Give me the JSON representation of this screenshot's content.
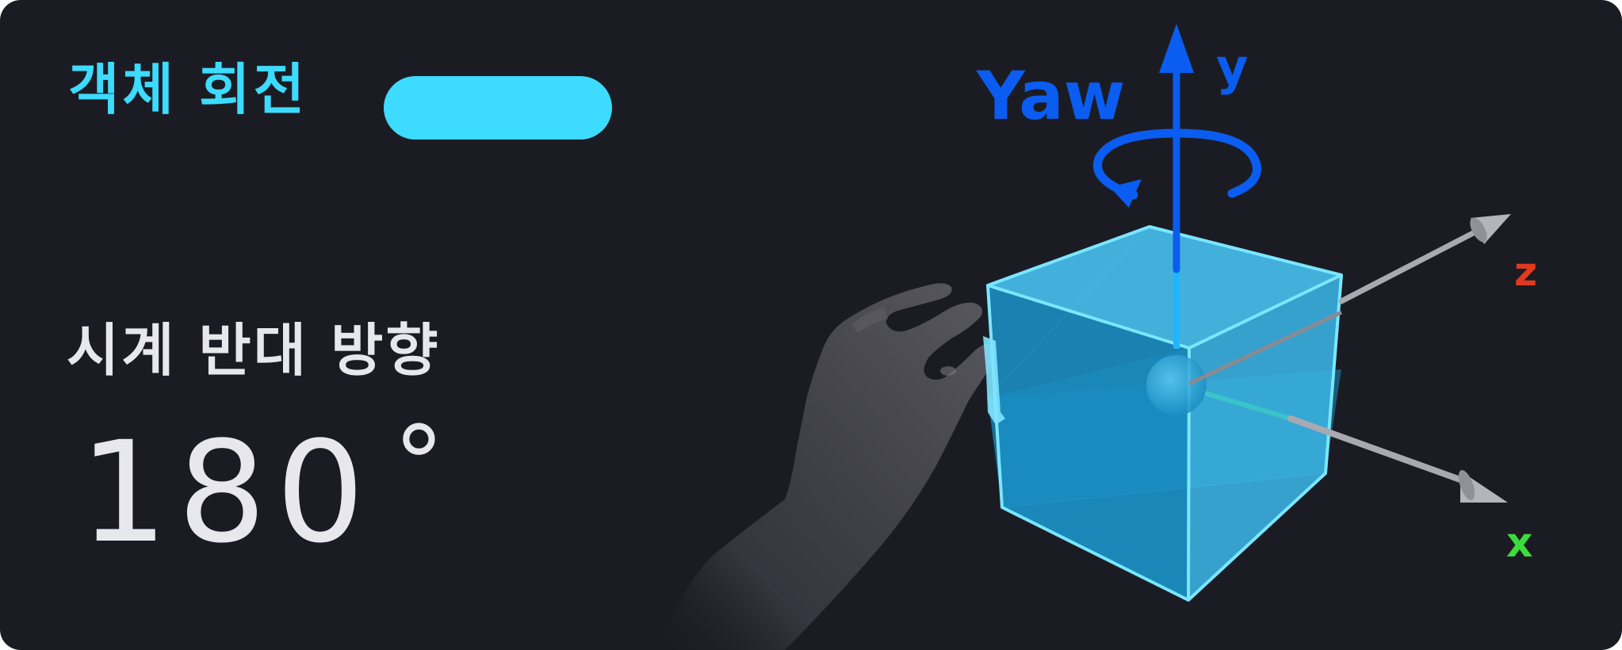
{
  "card": {
    "title": "객체 회전",
    "direction": "시계 반대 방향",
    "angle": "180",
    "angle_unit": "°"
  },
  "scene": {
    "rotation_label": "Yaw",
    "axes": {
      "y": "y",
      "z": "z",
      "x": "x"
    },
    "colors": {
      "background": "#1b1c23",
      "accent": "#3ddbff",
      "yaw": "#0a5df0",
      "axis_z": "#e03a1e",
      "axis_x": "#3ddc3a",
      "cube": "#1a9fd6"
    }
  }
}
